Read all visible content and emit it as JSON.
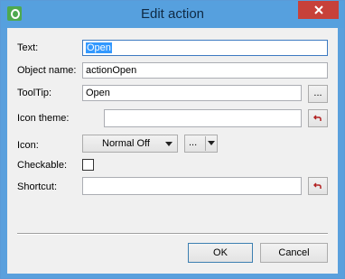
{
  "window": {
    "title": "Edit action"
  },
  "form": {
    "text_label": "Text:",
    "text_value": "Open",
    "object_name_label": "Object name:",
    "object_name_value": "actionOpen",
    "tooltip_label": "ToolTip:",
    "tooltip_value": "Open",
    "tooltip_more_label": "...",
    "icon_theme_label": "Icon theme:",
    "icon_theme_value": "",
    "icon_label": "Icon:",
    "icon_mode_selected": "Normal Off",
    "icon_more_label": "...",
    "checkable_label": "Checkable:",
    "checkable_checked": false,
    "shortcut_label": "Shortcut:",
    "shortcut_value": ""
  },
  "buttons": {
    "ok_label": "OK",
    "cancel_label": "Cancel"
  },
  "icons": {
    "app": "qt-designer-icon",
    "close": "close-icon",
    "reset": "reset-arrow-icon",
    "dropdown": "chevron-down-icon"
  },
  "colors": {
    "titlebar": "#56a0de",
    "close": "#c7413a",
    "reset_arrow": "#b22222",
    "selection": "#3399ff"
  }
}
